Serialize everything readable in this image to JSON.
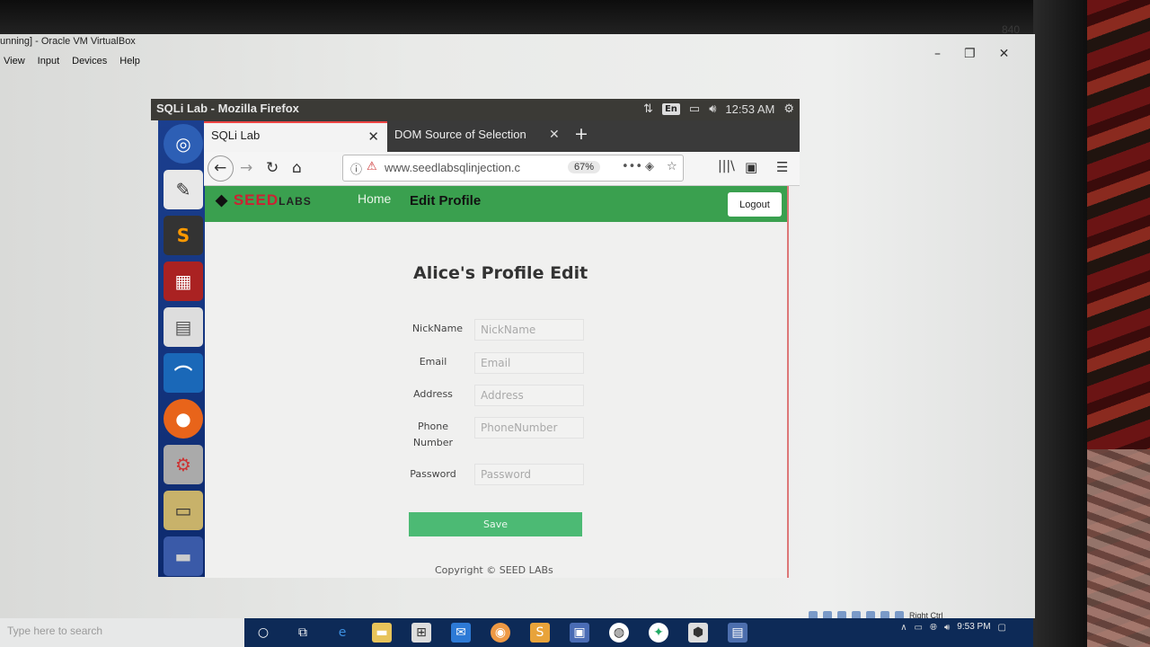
{
  "host": {
    "window_title": "unning] - Oracle VM VirtualBox",
    "menu": [
      "View",
      "Input",
      "Devices",
      "Help"
    ],
    "status_right": "Right Ctrl",
    "search_placeholder": "Type here to search",
    "clock_time": "9:53 PM",
    "bezel_label": "840"
  },
  "vm": {
    "window_title": "SQLi Lab - Mozilla Firefox",
    "tray": {
      "lang": "En",
      "time": "12:53 AM"
    },
    "tabs": [
      {
        "label": "SQLi Lab",
        "active": true
      },
      {
        "label": "DOM Source of Selection",
        "active": false
      }
    ],
    "url": "www.seedlabsqlinjection.c",
    "zoom": "67%"
  },
  "page": {
    "logo_main": "SEED",
    "logo_sub": "LABS",
    "nav": {
      "home": "Home",
      "edit": "Edit Profile"
    },
    "logout": "Logout",
    "title": "Alice's Profile Edit",
    "fields": [
      {
        "label": "NickName",
        "placeholder": "NickName"
      },
      {
        "label": "Email",
        "placeholder": "Email"
      },
      {
        "label": "Address",
        "placeholder": "Address"
      },
      {
        "label": "Phone Number",
        "placeholder": "PhoneNumber"
      },
      {
        "label": "Password",
        "placeholder": "Password"
      }
    ],
    "save": "Save",
    "copyright": "Copyright © SEED LABs"
  },
  "colors": {
    "header_green": "#3aa04f",
    "save_green": "#4cba74",
    "launcher_blue": "#1b3f8f"
  }
}
